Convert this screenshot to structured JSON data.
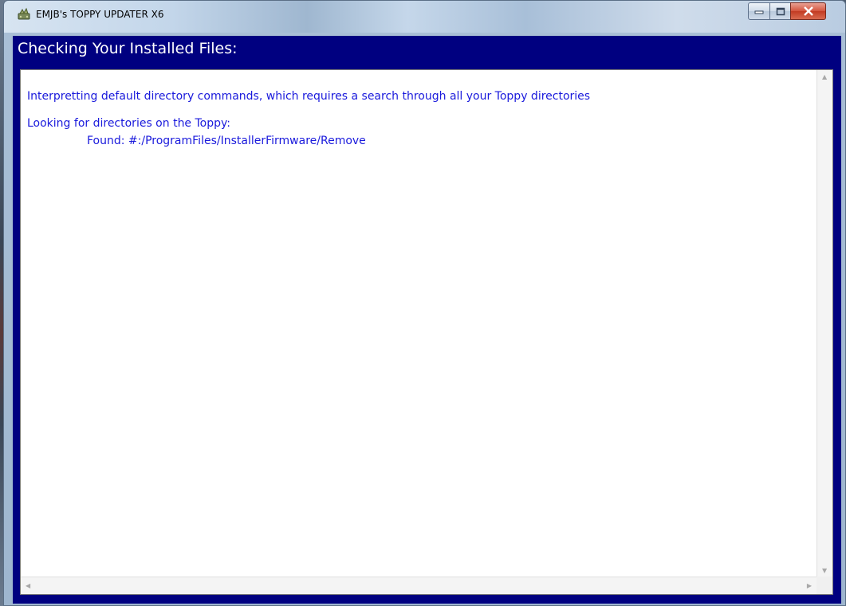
{
  "window": {
    "title": "EMJB's TOPPY UPDATER X6",
    "controls": {
      "minimize": "minimize",
      "maximize": "maximize",
      "close": "close"
    }
  },
  "header": {
    "title": "Checking Your Installed Files:"
  },
  "log": {
    "lines": [
      "Interpretting default directory commands, which requires a search through all your Toppy directories",
      "",
      "Looking for directories on the Toppy:",
      "Found: #:/ProgramFiles/InstallerFirmware/Remove"
    ]
  },
  "colors": {
    "header_bg": "#000080",
    "header_text": "#ffffff",
    "log_text": "#1a1adc",
    "log_bg": "#ffffff"
  },
  "icons": {
    "app": "toppy-updater-icon",
    "minimize": "minimize-icon",
    "maximize": "maximize-icon",
    "close": "close-icon",
    "scroll_up": "chevron-up-icon",
    "scroll_down": "chevron-down-icon",
    "scroll_left": "chevron-left-icon",
    "scroll_right": "chevron-right-icon"
  }
}
